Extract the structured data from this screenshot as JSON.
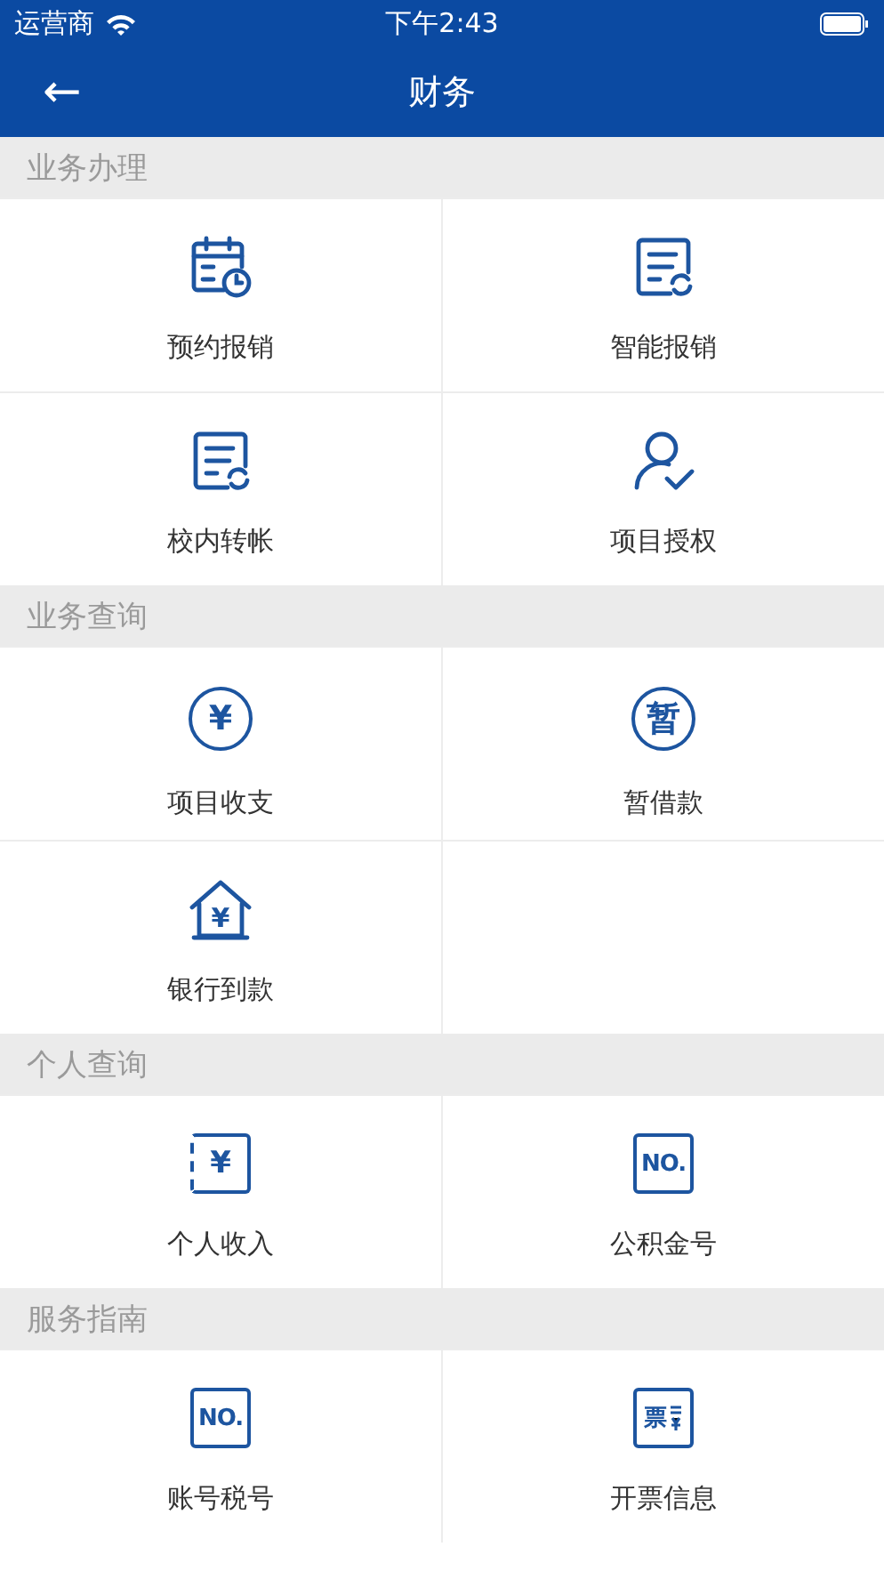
{
  "status_bar": {
    "carrier": "运营商",
    "time": "下午2:43"
  },
  "nav": {
    "back": "←",
    "title": "财务"
  },
  "sections": [
    {
      "title": "业务办理",
      "items": [
        {
          "label": "预约报销",
          "kind": "calendar"
        },
        {
          "label": "智能报销",
          "kind": "document"
        },
        {
          "label": "校内转帐",
          "kind": "document"
        },
        {
          "label": "项目授权",
          "kind": "user-check"
        }
      ]
    },
    {
      "title": "业务查询",
      "items": [
        {
          "label": "项目收支",
          "kind": "coin",
          "glyph": "¥"
        },
        {
          "label": "暂借款",
          "kind": "coin",
          "glyph": "暂"
        },
        {
          "label": "银行到款",
          "kind": "house",
          "glyph": "¥"
        }
      ]
    },
    {
      "title": "个人查询",
      "items": [
        {
          "label": "个人收入",
          "kind": "receipt",
          "glyph": "¥"
        },
        {
          "label": "公积金号",
          "kind": "badge",
          "glyph": "NO."
        }
      ]
    },
    {
      "title": "服务指南",
      "items": [
        {
          "label": "账号税号",
          "kind": "badge",
          "glyph": "NO."
        },
        {
          "label": "开票信息",
          "kind": "invoice",
          "glyph": "票"
        }
      ]
    }
  ]
}
